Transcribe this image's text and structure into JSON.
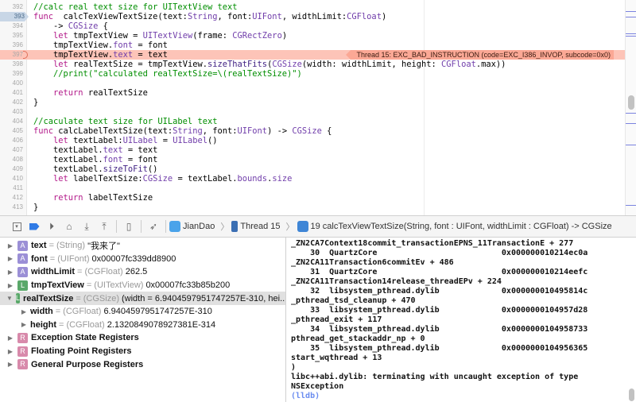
{
  "editor": {
    "lines": [
      {
        "n": "391",
        "tokens": []
      },
      {
        "n": "392",
        "tokens": [
          [
            "c",
            "//calc real text size for UITextView text"
          ]
        ]
      },
      {
        "n": "393",
        "current": true,
        "tokens": [
          [
            "k",
            "func"
          ],
          [
            "",
            "  calcTexViewTextSize(text:"
          ],
          [
            "t",
            "String"
          ],
          [
            "",
            ", font:"
          ],
          [
            "t",
            "UIFont"
          ],
          [
            "",
            ", widthLimit:"
          ],
          [
            "t",
            "CGFloat"
          ],
          [
            "",
            ")"
          ]
        ]
      },
      {
        "n": "394",
        "tokens": [
          [
            "",
            "    -> "
          ],
          [
            "t",
            "CGSize"
          ],
          [
            "",
            " {"
          ]
        ]
      },
      {
        "n": "395",
        "tokens": [
          [
            "",
            "    "
          ],
          [
            "k",
            "let"
          ],
          [
            "",
            " tmpTextView = "
          ],
          [
            "t",
            "UITextView"
          ],
          [
            "",
            "(frame: "
          ],
          [
            "t",
            "CGRectZero"
          ],
          [
            "",
            ")"
          ]
        ]
      },
      {
        "n": "396",
        "tokens": [
          [
            "",
            "    tmpTextView."
          ],
          [
            "t",
            "font"
          ],
          [
            "",
            " = font"
          ]
        ]
      },
      {
        "n": "397",
        "error": true,
        "tokens": [
          [
            "",
            "    tmpTextView."
          ],
          [
            "t",
            "text"
          ],
          [
            "",
            " = text"
          ]
        ]
      },
      {
        "n": "398",
        "tokens": [
          [
            "",
            "    "
          ],
          [
            "k",
            "let"
          ],
          [
            "",
            " realTextSize = tmpTextView."
          ],
          [
            "m",
            "sizeThatFits"
          ],
          [
            "",
            "("
          ],
          [
            "t",
            "CGSize"
          ],
          [
            "",
            "(width: widthLimit, height: "
          ],
          [
            "t",
            "CGFloat"
          ],
          [
            "",
            ".max))"
          ]
        ]
      },
      {
        "n": "399",
        "tokens": [
          [
            "c",
            "    //print(\"calculated realTextSize=\\(realTextSize)\")"
          ]
        ]
      },
      {
        "n": "400",
        "tokens": []
      },
      {
        "n": "401",
        "tokens": [
          [
            "",
            "    "
          ],
          [
            "k",
            "return"
          ],
          [
            "",
            " realTextSize"
          ]
        ]
      },
      {
        "n": "402",
        "tokens": [
          [
            "",
            "}"
          ]
        ]
      },
      {
        "n": "403",
        "tokens": []
      },
      {
        "n": "404",
        "tokens": [
          [
            "c",
            "//caculate text size for UILabel text"
          ]
        ]
      },
      {
        "n": "405",
        "tokens": [
          [
            "k",
            "func"
          ],
          [
            "",
            " calcLabelTextSize(text:"
          ],
          [
            "t",
            "String"
          ],
          [
            "",
            ", font:"
          ],
          [
            "t",
            "UIFont"
          ],
          [
            "",
            ") -> "
          ],
          [
            "t",
            "CGSize"
          ],
          [
            "",
            " {"
          ]
        ]
      },
      {
        "n": "406",
        "tokens": [
          [
            "",
            "    "
          ],
          [
            "k",
            "let"
          ],
          [
            "",
            " textLabel:"
          ],
          [
            "t",
            "UILabel"
          ],
          [
            "",
            " = "
          ],
          [
            "t",
            "UILabel"
          ],
          [
            "",
            "()"
          ]
        ]
      },
      {
        "n": "407",
        "tokens": [
          [
            "",
            "    textLabel."
          ],
          [
            "t",
            "text"
          ],
          [
            "",
            " = text"
          ]
        ]
      },
      {
        "n": "408",
        "tokens": [
          [
            "",
            "    textLabel."
          ],
          [
            "t",
            "font"
          ],
          [
            "",
            " = font"
          ]
        ]
      },
      {
        "n": "409",
        "tokens": [
          [
            "",
            "    textLabel."
          ],
          [
            "m",
            "sizeToFit"
          ],
          [
            "",
            "()"
          ]
        ]
      },
      {
        "n": "410",
        "tokens": [
          [
            "",
            "    "
          ],
          [
            "k",
            "let"
          ],
          [
            "",
            " labelTextSize:"
          ],
          [
            "t",
            "CGSize"
          ],
          [
            "",
            " = textLabel."
          ],
          [
            "t",
            "bounds"
          ],
          [
            "",
            "."
          ],
          [
            "t",
            "size"
          ]
        ]
      },
      {
        "n": "411",
        "tokens": []
      },
      {
        "n": "412",
        "tokens": [
          [
            "",
            "    "
          ],
          [
            "k",
            "return"
          ],
          [
            "",
            " labelTextSize"
          ]
        ]
      },
      {
        "n": "413",
        "tokens": [
          [
            "",
            "}"
          ]
        ]
      }
    ],
    "error_message": "Thread 15: EXC_BAD_INSTRUCTION (code=EXC_I386_INVOP, subcode=0x0)"
  },
  "debug_bar": {
    "buttons": [
      "hide-debug-area",
      "breakpoints-toggle",
      "continue",
      "step-over",
      "step-into",
      "step-out",
      "view-debugger",
      "simulate-location"
    ],
    "breadcrumb": {
      "app": "JianDao",
      "thread": "Thread 15",
      "frame": "19 calcTexViewTextSize(String, font : UIFont, widthLimit : CGFloat) -> CGSize"
    }
  },
  "variables": [
    {
      "badge": "A",
      "badge_color": "#9b8fd6",
      "name": "text",
      "type": "(String)",
      "value": "\"我来了\"",
      "expanded": false,
      "indent": 0
    },
    {
      "badge": "A",
      "badge_color": "#9b8fd6",
      "name": "font",
      "type": "(UIFont)",
      "value": "0x00007fc339dd8900",
      "expanded": false,
      "indent": 0
    },
    {
      "badge": "A",
      "badge_color": "#9b8fd6",
      "name": "widthLimit",
      "type": "(CGFloat)",
      "value": "262.5",
      "expanded": false,
      "indent": 0
    },
    {
      "badge": "L",
      "badge_color": "#5aa86a",
      "name": "tmpTextView",
      "type": "(UITextView)",
      "value": "0x00007fc33b85b200",
      "expanded": false,
      "indent": 0
    },
    {
      "badge": "L",
      "badge_color": "#5aa86a",
      "name": "realTextSize",
      "type": "(CGSize)",
      "value": "(width = 6.9404597951747257E-310, hei...",
      "expanded": true,
      "indent": 0,
      "selected": true
    },
    {
      "badge": "",
      "name": "width",
      "type": "(CGFloat)",
      "value": "6.9404597951747257E-310",
      "expanded": false,
      "indent": 1
    },
    {
      "badge": "",
      "name": "height",
      "type": "(CGFloat)",
      "value": "2.1320849078927381E-314",
      "expanded": false,
      "indent": 1
    },
    {
      "badge": "R",
      "badge_color": "#d88aab",
      "name": "Exception State Registers",
      "type": "",
      "value": "",
      "expanded": false,
      "indent": 0
    },
    {
      "badge": "R",
      "badge_color": "#d88aab",
      "name": "Floating Point Registers",
      "type": "",
      "value": "",
      "expanded": false,
      "indent": 0
    },
    {
      "badge": "R",
      "badge_color": "#d88aab",
      "name": "General Purpose Registers",
      "type": "",
      "value": "",
      "expanded": false,
      "indent": 0
    }
  ],
  "console": {
    "lines": [
      "_ZN2CA7Context18commit_transactionEPNS_11TransactionE + 277",
      "    30  QuartzCore                          0x000000010214ec0a",
      "_ZN2CA11Transaction6commitEv + 486",
      "    31  QuartzCore                          0x000000010214eefc",
      "_ZN2CA11Transaction14release_threadEPv + 224",
      "    32  libsystem_pthread.dylib             0x000000010495814c",
      "_pthread_tsd_cleanup + 470",
      "    33  libsystem_pthread.dylib             0x0000000104957d28",
      "_pthread_exit + 117",
      "    34  libsystem_pthread.dylib             0x0000000104958733",
      "pthread_get_stackaddr_np + 0",
      "    35  libsystem_pthread.dylib             0x0000000104956365",
      "start_wqthread + 13",
      ")",
      "libc++abi.dylib: terminating with uncaught exception of type",
      "NSException"
    ],
    "prompt": "(lldb)"
  }
}
